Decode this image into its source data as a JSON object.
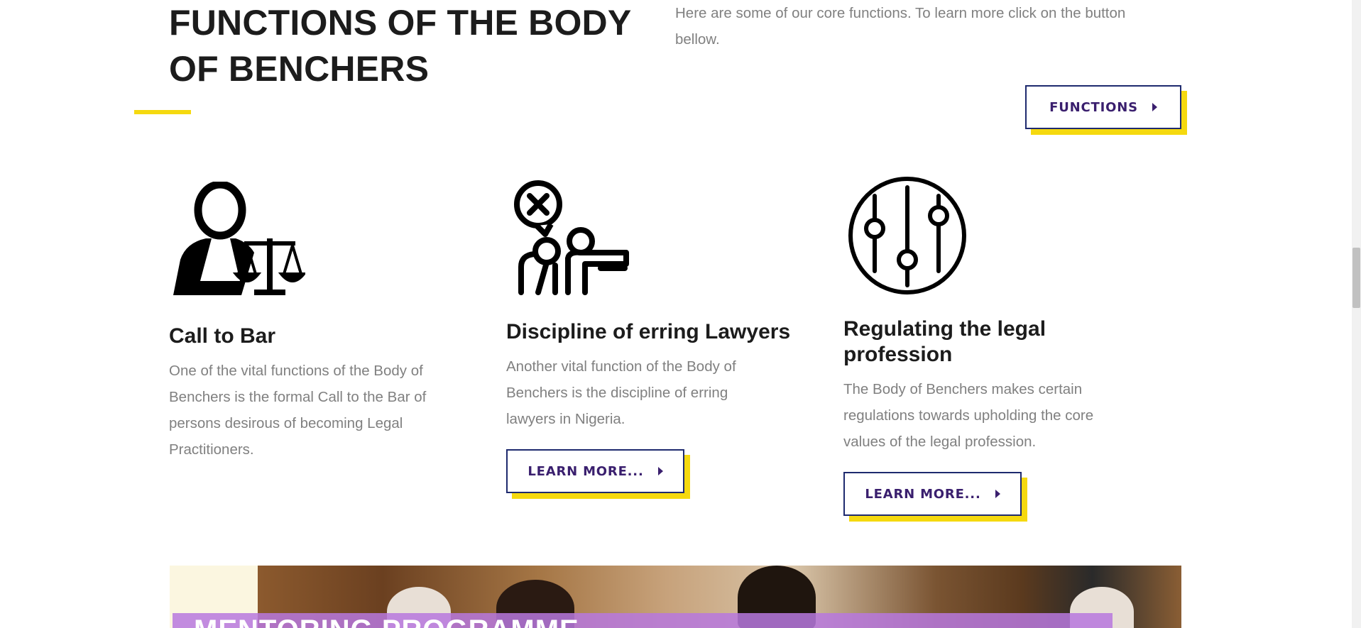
{
  "header": {
    "title": "FUNCTIONS OF THE BODY OF BENCHERS",
    "intro": "Here are some of our core functions. To learn more click on the button bellow.",
    "functions_button": "FUNCTIONS"
  },
  "cards": [
    {
      "icon": "lawyer-scales-icon",
      "title": "Call to Bar",
      "text": "One of the vital functions of the Body of Benchers is the formal Call to the Bar of persons desirous of becoming Legal Practitioners."
    },
    {
      "icon": "discipline-icon",
      "title": "Discipline of erring Lawyers",
      "text": "Another vital function of the Body of Benchers is the discipline of erring lawyers in Nigeria.",
      "button": "LEARN MORE..."
    },
    {
      "icon": "sliders-icon",
      "title": "Regulating the legal profession",
      "text": "The Body of Benchers makes certain regulations towards upholding the core values of the legal profession.",
      "button": "LEARN MORE..."
    }
  ],
  "banner": {
    "title": "MENTORING PROGRAMME"
  },
  "colors": {
    "accent_yellow": "#f5d90f",
    "button_border": "#1e2a6e",
    "button_text": "#3a1f6e",
    "overlay_purple": "#b778de"
  }
}
